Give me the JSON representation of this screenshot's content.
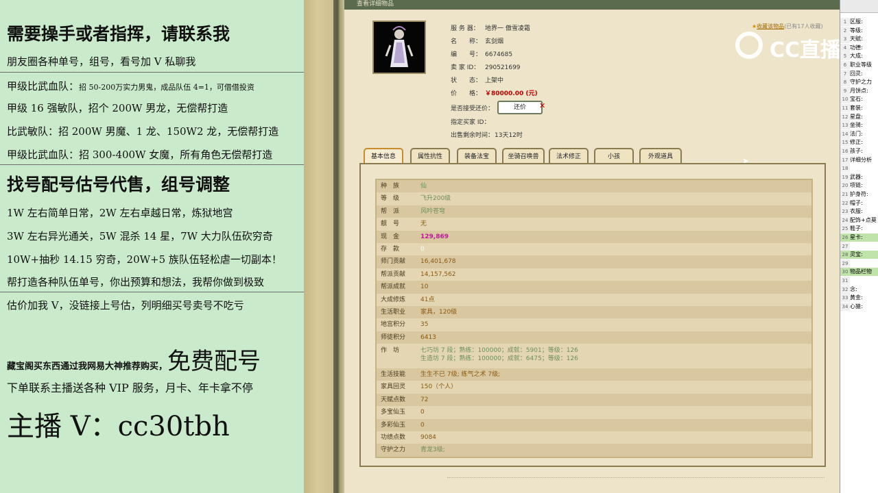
{
  "promo": {
    "line1": "需要操手或者指挥，请联系我",
    "line2": "朋友圈各种单号，组号，看号加 V 私聊我",
    "line3a": "甲级比武血队：",
    "line3b": "招 50-200万实力男鬼，成品队伍 4=1，可借借投资",
    "line4": "甲级 16 强敏队，招个 200W 男龙，无偿帮打造",
    "line5": "比武敏队：招 200W 男魔、1 龙、150W2 龙，无偿帮打造",
    "line6": "甲级比武血队：招 300-400W 女魔，所有角色无偿帮打造",
    "line7": "找号配号估号代售，组号调整",
    "line8": "1W 左右简单日常，2W 左右卓越日常，炼狱地宫",
    "line9": "3W 左右异光通关，5W 混杀 14 星，7W 大力队伍砍穷奇",
    "line10": "10W+抽秒 14.15 穷奇，20W+5 族队伍轻松虐一切副本！",
    "line11": "帮打造各种队伍单号，你出预算和想法，我帮你做到极致",
    "line12": "估价加我 V，没链接上号估，列明细买号卖号不吃亏",
    "line13a": "藏宝阁买东西通过我网易大神推荐购买，",
    "line13b": "免费配号",
    "line14": "下单联系主播送各种 VIP 服务，月卡、年卡拿不停",
    "line15": "主播 V：cc30tbh"
  },
  "window": {
    "title": "查看详细物品"
  },
  "item": {
    "server_label": "服 务 器：",
    "server": "地界一 傲雪凌霜",
    "name_label": "名　　称：",
    "name": "玄剑烟",
    "id_label": "编　　号：",
    "id": "6674685",
    "seller_label": "卖 家 ID：",
    "seller": "290521699",
    "status_label": "状　　态：",
    "status": "上架中",
    "price_label": "价　　格：",
    "price": "￥80000.00 (元)",
    "offer_label": "是否接受还价：",
    "offer_button": "还价",
    "buyer_label": "指定买家 ID：",
    "buyer": "",
    "time_label": "出售剩余时间：",
    "time": "13天12时",
    "collect": "收藏该物品",
    "collect_count": "(已有17人收藏)"
  },
  "tabs": [
    "基本信息",
    "属性抗性",
    "装备法宝",
    "坐骑召唤兽",
    "法术修正",
    "小孩",
    "外观道具"
  ],
  "info_rows": [
    {
      "label": "种　族",
      "value": "仙",
      "style": "green"
    },
    {
      "label": "等　级",
      "value": "飞升200级",
      "style": "green"
    },
    {
      "label": "帮　派",
      "value": "风吟苍穹",
      "style": "green"
    },
    {
      "label": "靓　号",
      "value": "无",
      "style": "brown"
    },
    {
      "label": "现　金",
      "value": "129,869",
      "style": "pink"
    },
    {
      "label": "存　款",
      "value": "0",
      "style": "white"
    },
    {
      "label": "师门贡献",
      "value": "16,401,678",
      "style": "brown"
    },
    {
      "label": "帮派贡献",
      "value": "14,157,562",
      "style": "brown"
    },
    {
      "label": "帮派成就",
      "value": "10",
      "style": "brown"
    },
    {
      "label": "大成修炼",
      "value": "41点",
      "style": "brown"
    },
    {
      "label": "生活职业",
      "value": "家具，120级",
      "style": "brown"
    },
    {
      "label": "地宫积分",
      "value": "35",
      "style": "brown"
    },
    {
      "label": "师徒积分",
      "value": "6413",
      "style": "brown"
    }
  ],
  "workshop": {
    "label": "作　坊",
    "line1": "七巧坊 7 段；熟练：100000；成就：5901；等级：126",
    "line2": "生造坊 7 段；熟练：100000；成就：6475；等级：126"
  },
  "info_rows2": [
    {
      "label": "生活技能",
      "value": "生生不已 7级; 练气之术 7级;",
      "style": "brown"
    },
    {
      "label": "家具回灵",
      "value": "150（个人）",
      "style": "brown"
    },
    {
      "label": "天赋点数",
      "value": "72",
      "style": "brown"
    },
    {
      "label": "多宝仙玉",
      "value": "0",
      "style": "brown"
    },
    {
      "label": "多彩仙玉",
      "value": "0",
      "style": "brown"
    },
    {
      "label": "功绩点数",
      "value": "9084",
      "style": "brown"
    },
    {
      "label": "守护之力",
      "value": "青龙3级;",
      "style": "green"
    }
  ],
  "logo": {
    "text": "CC直播"
  },
  "sheet_rows": [
    {
      "n": "1",
      "t": "区服:"
    },
    {
      "n": "2",
      "t": "等级:"
    },
    {
      "n": "3",
      "t": "天赋:"
    },
    {
      "n": "4",
      "t": "功德:"
    },
    {
      "n": "5",
      "t": "大成:"
    },
    {
      "n": "6",
      "t": "职业等级"
    },
    {
      "n": "7",
      "t": "回灵:"
    },
    {
      "n": "8",
      "t": "守护之力"
    },
    {
      "n": "9",
      "t": "月饼点:"
    },
    {
      "n": "10",
      "t": "宝石:"
    },
    {
      "n": "11",
      "t": "套装:"
    },
    {
      "n": "12",
      "t": "星盘:"
    },
    {
      "n": "13",
      "t": "坐骑:"
    },
    {
      "n": "14",
      "t": "法门:"
    },
    {
      "n": "15",
      "t": "修正:"
    },
    {
      "n": "16",
      "t": "孩子:"
    },
    {
      "n": "17",
      "t": "详细分析"
    },
    {
      "n": "18",
      "t": ""
    },
    {
      "n": "19",
      "t": "武器:"
    },
    {
      "n": "20",
      "t": "项链:"
    },
    {
      "n": "21",
      "t": "护身符:"
    },
    {
      "n": "22",
      "t": "帽子:"
    },
    {
      "n": "23",
      "t": "衣服:"
    },
    {
      "n": "24",
      "t": "配饰+点莫"
    },
    {
      "n": "25",
      "t": "鞋子:"
    },
    {
      "n": "26",
      "t": "星卡:"
    },
    {
      "n": "27",
      "t": ""
    },
    {
      "n": "28",
      "t": "灵宝:"
    },
    {
      "n": "29",
      "t": ""
    },
    {
      "n": "30",
      "t": "物品栏物"
    },
    {
      "n": "31",
      "t": ""
    },
    {
      "n": "32",
      "t": "念:"
    },
    {
      "n": "33",
      "t": "黄金:"
    },
    {
      "n": "34",
      "t": "心猿:"
    }
  ]
}
